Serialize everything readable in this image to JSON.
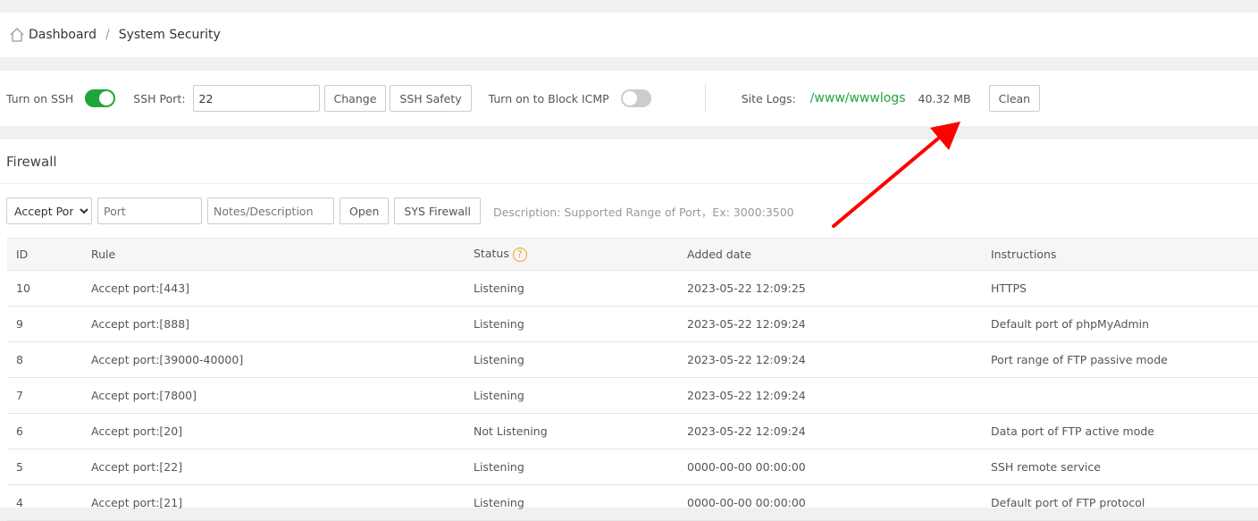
{
  "breadcrumb": {
    "home": "Dashboard",
    "current": "System Security"
  },
  "toolbar": {
    "ssh_label": "Turn on SSH",
    "ssh_on": true,
    "port_label": "SSH Port:",
    "port_value": "22",
    "change": "Change",
    "ssh_safety": "SSH Safety",
    "icmp_label": "Turn on to Block ICMP",
    "icmp_on": false,
    "logs_label": "Site Logs:",
    "logs_path": "/www/wwwlogs",
    "logs_size": "40.32 MB",
    "clean": "Clean"
  },
  "firewall": {
    "title": "Firewall",
    "select": "Accept Port",
    "port_placeholder": "Port",
    "notes_placeholder": "Notes/Description",
    "open": "Open",
    "sys": "SYS Firewall",
    "desc": "Description: Supported Range of Port，Ex: 3000:3500",
    "columns": [
      "ID",
      "Rule",
      "Status",
      "Added date",
      "Instructions"
    ],
    "rows": [
      [
        "10",
        "Accept port:[443]",
        "Listening",
        "2023-05-22 12:09:25",
        "HTTPS"
      ],
      [
        "9",
        "Accept port:[888]",
        "Listening",
        "2023-05-22 12:09:24",
        "Default port of phpMyAdmin"
      ],
      [
        "8",
        "Accept port:[39000-40000]",
        "Listening",
        "2023-05-22 12:09:24",
        "Port range of FTP passive mode"
      ],
      [
        "7",
        "Accept port:[7800]",
        "Listening",
        "2023-05-22 12:09:24",
        ""
      ],
      [
        "6",
        "Accept port:[20]",
        "Not Listening",
        "2023-05-22 12:09:24",
        "Data port of FTP active mode"
      ],
      [
        "5",
        "Accept port:[22]",
        "Listening",
        "0000-00-00 00:00:00",
        "SSH remote service"
      ],
      [
        "4",
        "Accept port:[21]",
        "Listening",
        "0000-00-00 00:00:00",
        "Default port of FTP protocol"
      ]
    ]
  },
  "colors": {
    "accent": "#20a53a",
    "arrow": "#ff0000"
  }
}
